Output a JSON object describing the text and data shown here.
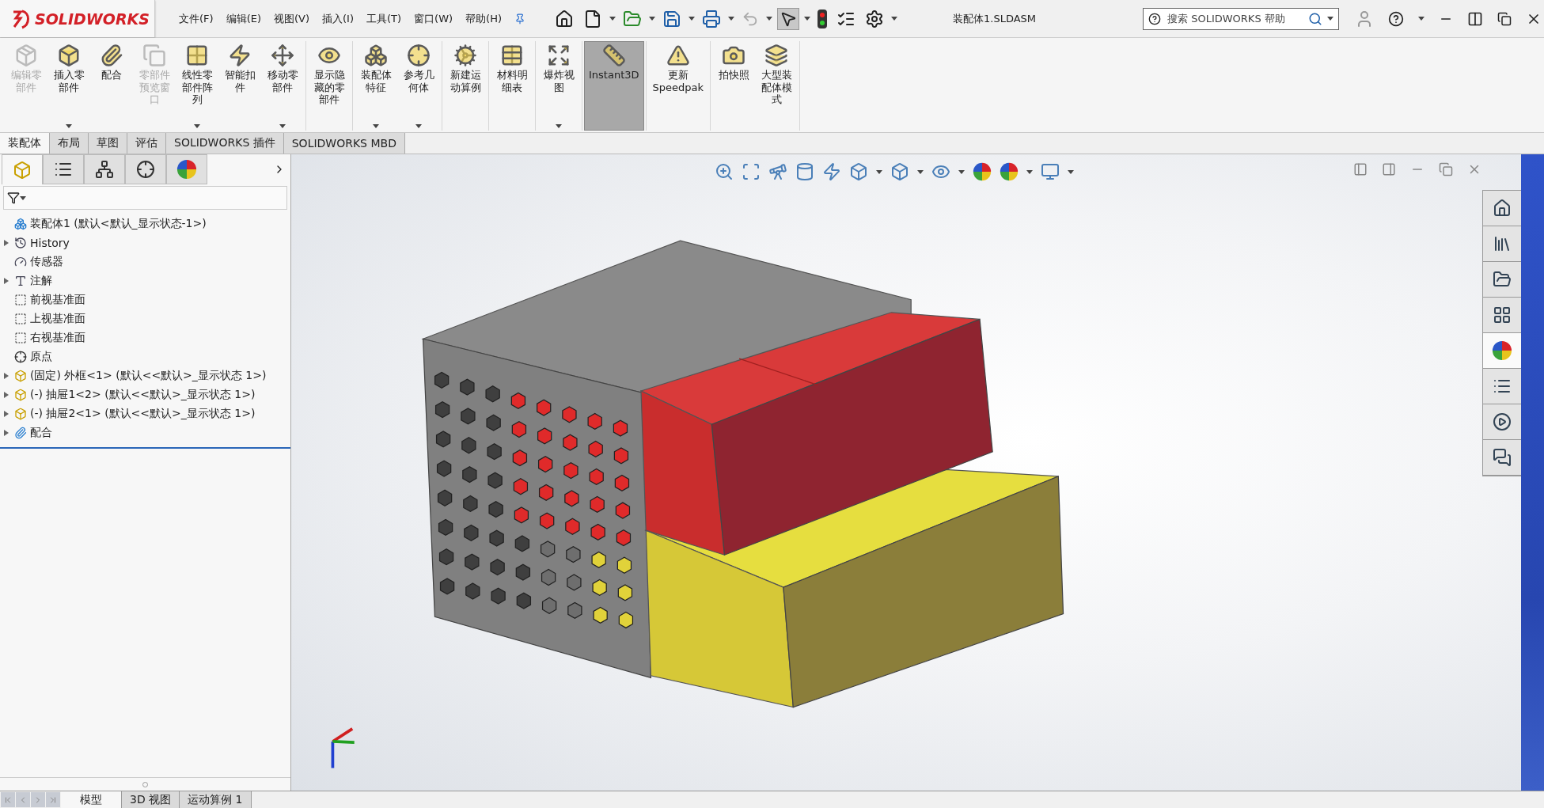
{
  "title_bar": {
    "logo": "SOLIDWORKS",
    "menus": [
      "文件(F)",
      "编辑(E)",
      "视图(V)",
      "插入(I)",
      "工具(T)",
      "窗口(W)",
      "帮助(H)"
    ],
    "document_title": "装配体1.SLDASM",
    "search": {
      "placeholder": "搜索 SOLIDWORKS 帮助"
    }
  },
  "ribbon": {
    "groups": [
      [
        {
          "label": "编辑零部件",
          "disabled": true,
          "dropdown": false,
          "selected": false
        },
        {
          "label": "插入零部件",
          "disabled": false,
          "dropdown": true,
          "selected": false
        },
        {
          "label": "配合",
          "disabled": false,
          "dropdown": false,
          "selected": false
        },
        {
          "label": "零部件预览窗口",
          "disabled": true,
          "dropdown": false,
          "selected": false
        },
        {
          "label": "线性零部件阵列",
          "disabled": false,
          "dropdown": true,
          "selected": false
        },
        {
          "label": "智能扣件",
          "disabled": false,
          "dropdown": false,
          "selected": false
        },
        {
          "label": "移动零部件",
          "disabled": false,
          "dropdown": true,
          "selected": false
        }
      ],
      [
        {
          "label": "显示隐藏的零部件",
          "disabled": false,
          "dropdown": false,
          "selected": false
        }
      ],
      [
        {
          "label": "装配体特征",
          "disabled": false,
          "dropdown": true,
          "selected": false
        },
        {
          "label": "参考几何体",
          "disabled": false,
          "dropdown": true,
          "selected": false
        }
      ],
      [
        {
          "label": "新建运动算例",
          "disabled": false,
          "dropdown": false,
          "selected": false
        }
      ],
      [
        {
          "label": "材料明细表",
          "disabled": false,
          "dropdown": false,
          "selected": false
        }
      ],
      [
        {
          "label": "爆炸视图",
          "disabled": false,
          "dropdown": true,
          "selected": false
        }
      ],
      [
        {
          "label": "Instant3D",
          "disabled": false,
          "dropdown": false,
          "selected": true
        }
      ],
      [
        {
          "label": "更新 Speedpak",
          "disabled": false,
          "dropdown": false,
          "selected": false
        }
      ],
      [
        {
          "label": "拍快照",
          "disabled": false,
          "dropdown": false,
          "selected": false
        },
        {
          "label": "大型装配体模式",
          "disabled": false,
          "dropdown": false,
          "selected": false
        }
      ]
    ]
  },
  "command_tabs": [
    {
      "label": "装配体",
      "selected": true
    },
    {
      "label": "布局",
      "selected": false
    },
    {
      "label": "草图",
      "selected": false
    },
    {
      "label": "评估",
      "selected": false
    },
    {
      "label": "SOLIDWORKS 插件",
      "selected": false
    },
    {
      "label": "SOLIDWORKS MBD",
      "selected": false
    }
  ],
  "panel_tabs": [
    {
      "selected": true
    },
    {
      "selected": false
    },
    {
      "selected": false
    },
    {
      "selected": false
    },
    {
      "selected": false
    }
  ],
  "tree": {
    "label": "装配体1 (默认<默认_显示状态-1>)",
    "kind": "assembly",
    "expandable": false,
    "children": [
      {
        "label": "History",
        "kind": "history",
        "expandable": true
      },
      {
        "label": "传感器",
        "kind": "sensor",
        "expandable": false
      },
      {
        "label": "注解",
        "kind": "annotation",
        "expandable": true
      },
      {
        "label": "前视基准面",
        "kind": "plane",
        "expandable": false
      },
      {
        "label": "上视基准面",
        "kind": "plane",
        "expandable": false
      },
      {
        "label": "右视基准面",
        "kind": "plane",
        "expandable": false
      },
      {
        "label": "原点",
        "kind": "origin",
        "expandable": false
      },
      {
        "label": "(固定) 外框<1> (默认<<默认>_显示状态 1>)",
        "kind": "part",
        "expandable": true
      },
      {
        "label": "(-) 抽屉1<2> (默认<<默认>_显示状态 1>)",
        "kind": "part",
        "expandable": true
      },
      {
        "label": "(-) 抽屉2<1> (默认<<默认>_显示状态 1>)",
        "kind": "part",
        "expandable": true
      },
      {
        "label": "配合",
        "kind": "mates",
        "expandable": true
      }
    ]
  },
  "bottom_tabs": [
    {
      "label": "模型",
      "selected": true
    },
    {
      "label": "3D 视图",
      "selected": false
    },
    {
      "label": "运动算例 1",
      "selected": false
    }
  ]
}
